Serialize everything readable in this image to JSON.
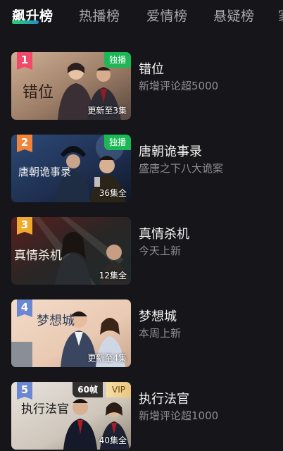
{
  "tabs": [
    {
      "label": "飙升榜",
      "active": true
    },
    {
      "label": "热播榜",
      "active": false
    },
    {
      "label": "爱情榜",
      "active": false
    },
    {
      "label": "悬疑榜",
      "active": false
    },
    {
      "label": "家",
      "active": false
    }
  ],
  "colors": {
    "background": "#16161a",
    "rank_1": "#f04a6a",
    "rank_2": "#f2843a",
    "rank_3": "#f0a92c",
    "rank_4": "#6b87d4",
    "rank_5": "#6b87d4",
    "exclusive_badge": "#1bb855"
  },
  "items": [
    {
      "rank": "1",
      "title": "错位",
      "subtitle": "新增评论超5000",
      "badge": "独播",
      "episodes": "更新至3集",
      "poster_text": "错位"
    },
    {
      "rank": "2",
      "title": "唐朝诡事录",
      "subtitle": "盛唐之下八大诡案",
      "badge": "独播",
      "episodes": "36集全",
      "poster_text": "唐朝诡事录"
    },
    {
      "rank": "3",
      "title": "真情杀机",
      "subtitle": "今天上新",
      "episodes": "12集全",
      "poster_text": "真情杀机"
    },
    {
      "rank": "4",
      "title": "梦想城",
      "subtitle": "本周上新",
      "episodes": "更新至4集",
      "poster_text": "梦想城"
    },
    {
      "rank": "5",
      "title": "执行法官",
      "subtitle": "新增评论超1000",
      "badge_fps": "60帧",
      "badge_vip": "VIP",
      "episodes": "40集全",
      "poster_text": "执行法官"
    }
  ]
}
